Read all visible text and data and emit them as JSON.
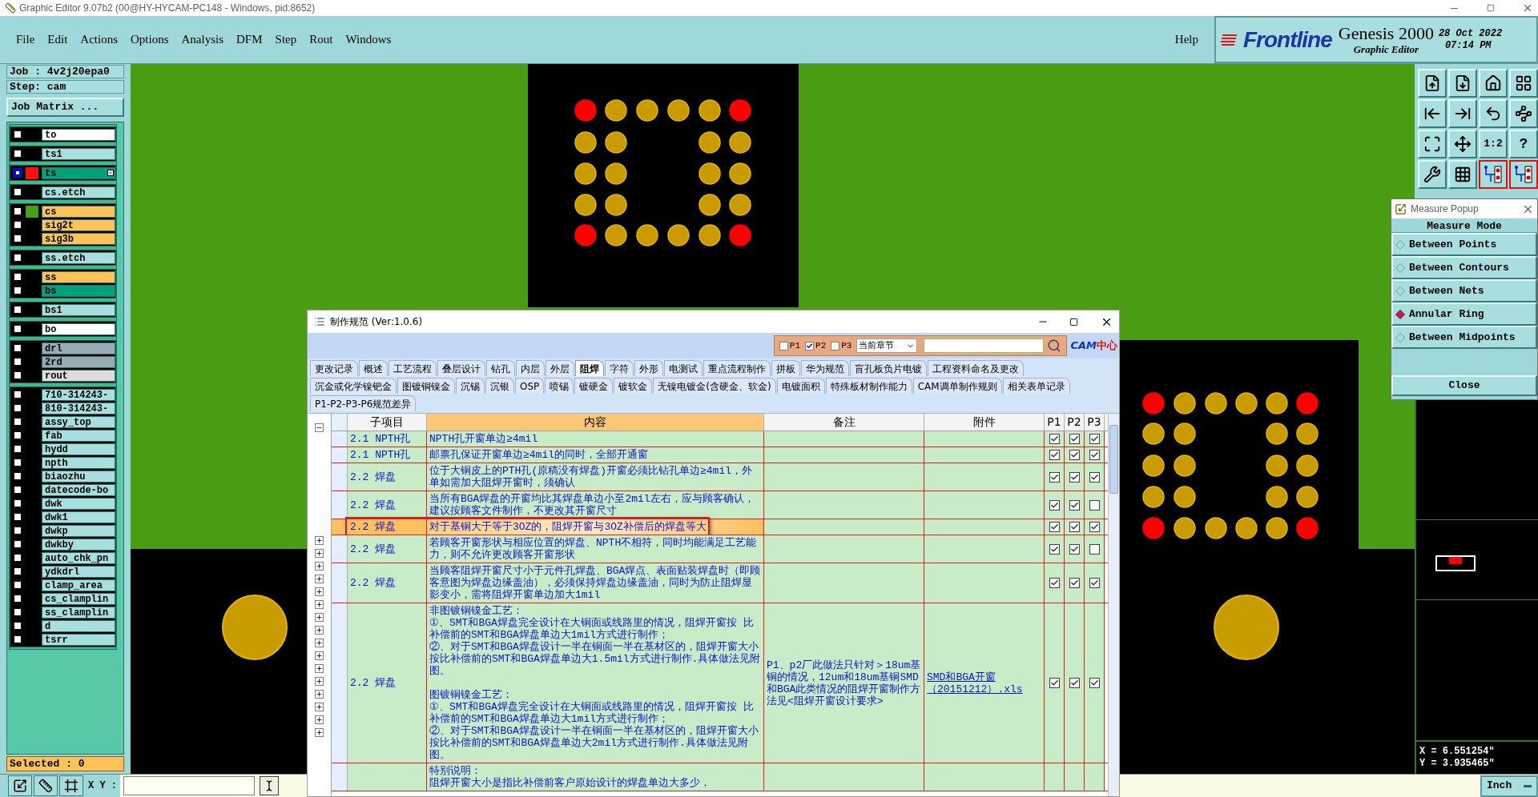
{
  "title_bar": {
    "title": "Graphic Editor 9.07b2 (00@HY-HYCAM-PC148 - Windows, pid:8652)"
  },
  "menu": {
    "items": [
      "File",
      "Edit",
      "Actions",
      "Options",
      "Analysis",
      "DFM",
      "Step",
      "Rout",
      "Windows"
    ],
    "help": "Help"
  },
  "brand": {
    "logo": "Frontline",
    "product": "Genesis 2000",
    "subtitle": "Graphic Editor",
    "date": "28 Oct 2022",
    "time": "07:14 PM"
  },
  "job_panel": {
    "job": "Job : 4v2j20epa0",
    "step": "Step: cam",
    "matrix_button": "Job Matrix ...",
    "layer_groups": [
      [
        {
          "name": "to",
          "color": "#ffffff",
          "selected": false
        }
      ],
      [
        {
          "name": "ts1",
          "color": "#a8dede",
          "selected": false
        }
      ],
      [
        {
          "name": "ts",
          "color": "#00a078",
          "swatch": {
            "color": "#ff1010"
          },
          "selected": true
        }
      ],
      [
        {
          "name": "cs.etch",
          "color": "#a8dede",
          "selected": false
        }
      ],
      [
        {
          "name": "cs",
          "color": "#fcc458",
          "swatch": {
            "color": "#48a018"
          },
          "selected": false
        },
        {
          "name": "sig2t",
          "color": "#fcc458",
          "selected": false
        },
        {
          "name": "sig3b",
          "color": "#fcc458",
          "selected": false
        }
      ],
      [
        {
          "name": "ss.etch",
          "color": "#a8dede",
          "selected": false
        }
      ],
      [
        {
          "name": "ss",
          "color": "#fcc458",
          "selected": false
        },
        {
          "name": "bs",
          "color": "#00a078",
          "selected": false
        }
      ],
      [
        {
          "name": "bs1",
          "color": "#a8dede",
          "selected": false
        }
      ],
      [
        {
          "name": "bo",
          "color": "#ffffff",
          "selected": false
        }
      ],
      [
        {
          "name": "drl",
          "color": "#98aab4",
          "selected": false
        },
        {
          "name": "2rd",
          "color": "#98aab4",
          "selected": false
        },
        {
          "name": "rout",
          "color": "#dcdcdc",
          "selected": false
        }
      ],
      [
        {
          "name": "710-314243-",
          "color": "#a8dede",
          "selected": false
        },
        {
          "name": "810-314243-",
          "color": "#a8dede",
          "selected": false
        },
        {
          "name": "assy_top",
          "color": "#a8dede",
          "selected": false
        },
        {
          "name": "fab",
          "color": "#a8dede",
          "selected": false
        },
        {
          "name": "hydd",
          "color": "#a8dede",
          "selected": false
        },
        {
          "name": "npth",
          "color": "#a8dede",
          "selected": false
        },
        {
          "name": "biaozhu",
          "color": "#a8dede",
          "selected": false
        },
        {
          "name": "datecode-bo",
          "color": "#a8dede",
          "selected": false
        },
        {
          "name": "dwk",
          "color": "#a8dede",
          "selected": false
        },
        {
          "name": "dwk1",
          "color": "#a8dede",
          "selected": false
        },
        {
          "name": "dwkp",
          "color": "#a8dede",
          "selected": false
        },
        {
          "name": "dwkby",
          "color": "#a8dede",
          "selected": false
        },
        {
          "name": "auto_chk_pn",
          "color": "#a8dede",
          "selected": false
        },
        {
          "name": "ydkdrl",
          "color": "#a8dede",
          "selected": false
        },
        {
          "name": "clamp_area",
          "color": "#a8dede",
          "selected": false
        },
        {
          "name": "cs_clamplin",
          "color": "#a8dede",
          "selected": false
        },
        {
          "name": "ss_clamplin",
          "color": "#a8dede",
          "selected": false
        },
        {
          "name": "d",
          "color": "#a8dede",
          "selected": false
        },
        {
          "name": "tsrr",
          "color": "#a8dede",
          "selected": false
        }
      ]
    ],
    "selected_count": "Selected : 0"
  },
  "toolbar_texts": [
    "1:2",
    "?"
  ],
  "measure_popup": {
    "title": "Measure Popup",
    "header": "Measure Mode",
    "options": [
      {
        "label": "Between Points",
        "selected": false
      },
      {
        "label": "Between Contours",
        "selected": false
      },
      {
        "label": "Between Nets",
        "selected": false
      },
      {
        "label": "Annular Ring",
        "selected": true
      },
      {
        "label": "Between Midpoints",
        "selected": false
      }
    ],
    "close": "Close"
  },
  "coordinates": {
    "x": "X = 6.551254\"",
    "y": "Y = 3.935465\""
  },
  "status_bar": {
    "xy_label": "X Y :",
    "units": "Inch"
  },
  "dialog": {
    "title": "制作规范 (Ver:1.0.6)",
    "filters": [
      {
        "label": "P1",
        "checked": false
      },
      {
        "label": "P2",
        "checked": true
      },
      {
        "label": "P3",
        "checked": false
      }
    ],
    "scope": "当前章节",
    "logo": [
      "CAM",
      "中心"
    ],
    "tab_rows": [
      [
        {
          "label": "更改记录",
          "selected": false
        },
        {
          "label": "概述",
          "selected": false
        },
        {
          "label": "工艺流程",
          "selected": false
        },
        {
          "label": "叠层设计",
          "selected": false
        },
        {
          "label": "钻孔",
          "selected": false
        },
        {
          "label": "内层",
          "selected": false
        },
        {
          "label": "外层",
          "selected": false
        },
        {
          "label": "阻焊",
          "selected": true
        },
        {
          "label": "字符",
          "selected": false
        },
        {
          "label": "外形",
          "selected": false
        },
        {
          "label": "电测试",
          "selected": false
        },
        {
          "label": "重点流程制作",
          "selected": false
        },
        {
          "label": "拼板",
          "selected": false
        },
        {
          "label": "华为规范",
          "selected": false
        },
        {
          "label": "盲孔板负片电镀",
          "selected": false
        },
        {
          "label": "工程资料命名及更改",
          "selected": false
        }
      ],
      [
        {
          "label": "沉金或化学镍钯金",
          "selected": false
        },
        {
          "label": "图镀铜镍金",
          "selected": false
        },
        {
          "label": "沉锡",
          "selected": false
        },
        {
          "label": "沉银",
          "selected": false
        },
        {
          "label": "OSP",
          "selected": false
        },
        {
          "label": "喷锡",
          "selected": false
        },
        {
          "label": "镀硬金",
          "selected": false
        },
        {
          "label": "镀软金",
          "selected": false
        },
        {
          "label": "无镍电镀金(含硬金、软金)",
          "selected": false
        },
        {
          "label": "电镀面积",
          "selected": false
        },
        {
          "label": "特殊板材制作能力",
          "selected": false
        },
        {
          "label": "CAM调单制作规则",
          "selected": false
        },
        {
          "label": "相关表单记录",
          "selected": false
        }
      ],
      [
        {
          "label": "P1-P2-P3-P6规范差异",
          "selected": false
        }
      ]
    ],
    "tree_nodes": [
      {
        "expanded": true
      },
      {
        "expanded": false
      },
      {
        "expanded": false
      },
      {
        "expanded": false
      },
      {
        "expanded": false
      },
      {
        "expanded": false
      },
      {
        "expanded": false
      },
      {
        "expanded": false
      },
      {
        "expanded": false
      },
      {
        "expanded": false
      },
      {
        "expanded": false
      },
      {
        "expanded": false
      },
      {
        "expanded": false
      },
      {
        "expanded": false
      },
      {
        "expanded": false
      },
      {
        "expanded": false
      },
      {
        "expanded": false
      }
    ],
    "columns": [
      "子项目",
      "内容",
      "备注",
      "附件",
      "P1",
      "P2",
      "P3"
    ],
    "rows": [
      {
        "item": "2.1 NPTH孔",
        "content": [
          [
            "NPTH孔开窗单边≥4mil"
          ]
        ],
        "checks": [
          true,
          true,
          true
        ],
        "selected": false,
        "annotated": false
      },
      {
        "item": "2.1 NPTH孔",
        "content": [
          [
            "邮票孔保证开窗单边≥4mil的同时，全部开通窗"
          ]
        ],
        "checks": [
          true,
          true,
          true
        ],
        "selected": false,
        "annotated": false
      },
      {
        "item": "2.2 焊盘",
        "content": [
          [
            "位于大铜皮上的PTH孔(原稿没有焊盘)开窗必须比钻孔单边≥4mil，外单如需加大阻焊开窗时，须确认"
          ]
        ],
        "checks": [
          true,
          true,
          true
        ],
        "selected": false,
        "annotated": false
      },
      {
        "item": "2.2 焊盘",
        "content": [
          [
            "当所有BGA焊盘的开窗均比其焊盘单边小至2mil左右，应与顾客确认，建议按顾客文件制作，不更改其开窗尺寸"
          ]
        ],
        "checks": [
          true,
          true,
          false
        ],
        "selected": false,
        "annotated": false
      },
      {
        "item": "2.2 焊盘",
        "content": [
          [
            "对于基铜大于等于3OZ的，阻焊开窗与3OZ补偿后的焊盘等大"
          ]
        ],
        "checks": [
          true,
          true,
          true
        ],
        "selected": true,
        "annotated": true
      },
      {
        "item": "2.2 焊盘",
        "content": [
          [
            "若顾客开窗形状与相应位置的焊盘、NPTH不相符，同时均能满足工艺能力，则不允许更改顾客开窗形状"
          ]
        ],
        "checks": [
          true,
          true,
          false
        ],
        "selected": false,
        "annotated": false
      },
      {
        "item": "2.2 焊盘",
        "content": [
          [
            "当顾客阻焊开窗尺寸小于元件孔焊盘、BGA焊点、表面贴装焊盘时（即顾客意图为焊盘边缘盖油），必须保持焊盘边缘盖油，同时为防止阻焊显影变小，需将阻焊开窗单边加大1mil"
          ]
        ],
        "checks": [
          true,
          true,
          true
        ],
        "selected": false,
        "annotated": false
      },
      {
        "item": "2.2 焊盘",
        "content": [
          [
            "非图镀铜镍金工艺：",
            "①、SMT和BGA焊盘完全设计在大铜面或线路里的情况，阻焊开窗按 比补偿前的SMT和BGA焊盘单边大1mil方式进行制作；",
            "②、对于SMT和BGA焊盘设计一半在铜面一半在基材区的，阻焊开窗大小按比补偿前的SMT和BGA焊盘单边大1.5mil方式进行制作.具体做法见附图。"
          ],
          [
            "图镀铜镍金工艺：",
            "①、SMT和BGA焊盘完全设计在大铜面或线路里的情况，阻焊开窗按 比补偿前的SMT和BGA焊盘单边大1mil方式进行制作；",
            "②、对于SMT和BGA焊盘设计一半在铜面一半在基材区的，阻焊开窗大小按比补偿前的SMT和BGA焊盘单边大2mil方式进行制作.具体做法见附图。"
          ]
        ],
        "note": "P1、p2厂此做法只针对＞18um基铜的情况，12um和18um基铜SMD和BGA此类情况的阻焊开窗制作方法见<阻焊开窗设计要求>",
        "attachment": "SMD和BGA开窗（20151212）.xls",
        "checks": [
          true,
          true,
          true
        ],
        "selected": false,
        "annotated": false
      },
      {
        "content": [
          [
            "特别说明：",
            "阻焊开窗大小是指比补偿前客户原始设计的焊盘单边大多少，"
          ]
        ],
        "selected": false,
        "annotated": false
      }
    ]
  }
}
